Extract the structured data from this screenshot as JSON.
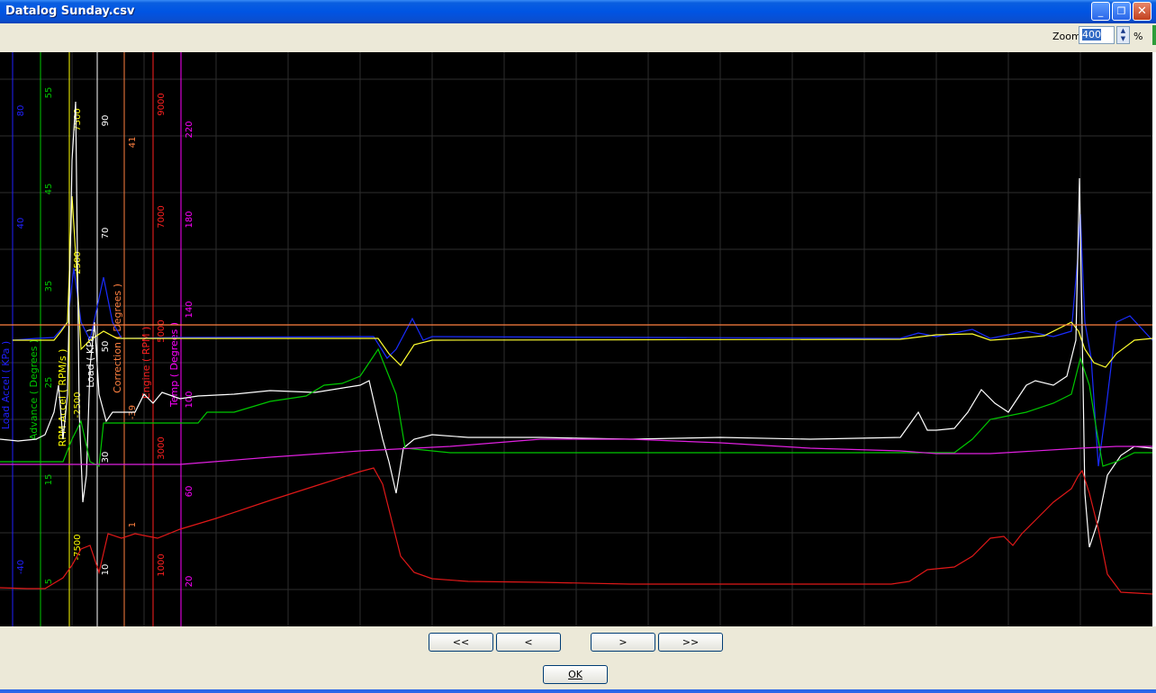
{
  "window": {
    "title": "Datalog Sunday.csv",
    "controls": {
      "minimize": "_",
      "restore": "❐",
      "close": "✕"
    }
  },
  "toolbar": {
    "zoom_label": "Zoom",
    "zoom_value": "400",
    "zoom_unit": "%"
  },
  "nav": {
    "first": "<<",
    "prev": "<",
    "next": ">",
    "last": ">>"
  },
  "ok_label": "OK",
  "colors": {
    "load_accel": "#0000ff",
    "advance": "#00c800",
    "rpm_accel": "#ffff00",
    "load": "#ffffff",
    "correction": "#ff8040",
    "engine": "#ff0000",
    "temp": "#ff00ff",
    "grid": "#333333"
  },
  "axes": [
    {
      "id": "load_accel",
      "label": "Load Accel ( KPa )",
      "ticks": [
        "80",
        "40",
        "-40"
      ],
      "color": "#2020ff"
    },
    {
      "id": "advance",
      "label": "Advance ( Degrees )",
      "ticks": [
        "55",
        "45",
        "35",
        "25",
        "15",
        "5"
      ],
      "color": "#00c800"
    },
    {
      "id": "rpm_accel",
      "label": "RPM Accel ( RPM/s )",
      "ticks": [
        "7500",
        "2500",
        "-2500",
        "-7500"
      ],
      "color": "#ffff00"
    },
    {
      "id": "load",
      "label": "Load ( KPa )",
      "ticks": [
        "90",
        "70",
        "50",
        "30",
        "10"
      ],
      "color": "#ffffff"
    },
    {
      "id": "correction",
      "label": "Correction ( Degrees )",
      "ticks": [
        "41",
        "1",
        "-39"
      ],
      "color": "#ff8040"
    },
    {
      "id": "engine",
      "label": "Engine ( RPM )",
      "ticks": [
        "9000",
        "7000",
        "5000",
        "3000",
        "1000"
      ],
      "color": "#ff2020"
    },
    {
      "id": "temp",
      "label": "Temp ( Degrees )",
      "ticks": [
        "220",
        "180",
        "140",
        "100",
        "60",
        "20"
      ],
      "color": "#ff00ff"
    }
  ],
  "chart_data": {
    "type": "line",
    "x_samples": 17,
    "series": [
      {
        "name": "Engine ( RPM )",
        "unit": "RPM",
        "values": [
          650,
          700,
          1150,
          1300,
          1850,
          2500,
          3100,
          1100,
          850,
          800,
          780,
          780,
          780,
          1000,
          1800,
          2700,
          650
        ]
      },
      {
        "name": "Load ( KPa )",
        "unit": "KPa",
        "values": [
          41,
          41,
          47,
          48,
          49,
          51,
          53,
          41,
          41,
          41,
          41,
          42,
          42,
          43,
          50,
          52,
          42
        ]
      },
      {
        "name": "Advance ( Degrees )",
        "unit": "Degrees",
        "values": [
          12,
          12,
          22,
          24,
          26,
          29,
          30,
          18,
          18,
          18,
          18,
          18,
          18,
          18,
          21,
          26,
          18
        ]
      },
      {
        "name": "Temp ( Degrees )",
        "unit": "Degrees",
        "values": [
          88,
          88,
          89,
          93,
          94,
          95,
          96,
          97,
          97,
          97,
          96,
          96,
          96,
          96,
          97,
          97,
          97
        ]
      },
      {
        "name": "Correction ( Degrees )",
        "unit": "Degrees",
        "values": [
          1,
          1,
          1,
          1,
          1,
          1,
          1,
          1,
          1,
          1,
          1,
          1,
          1,
          1,
          1,
          1,
          1
        ]
      }
    ]
  }
}
